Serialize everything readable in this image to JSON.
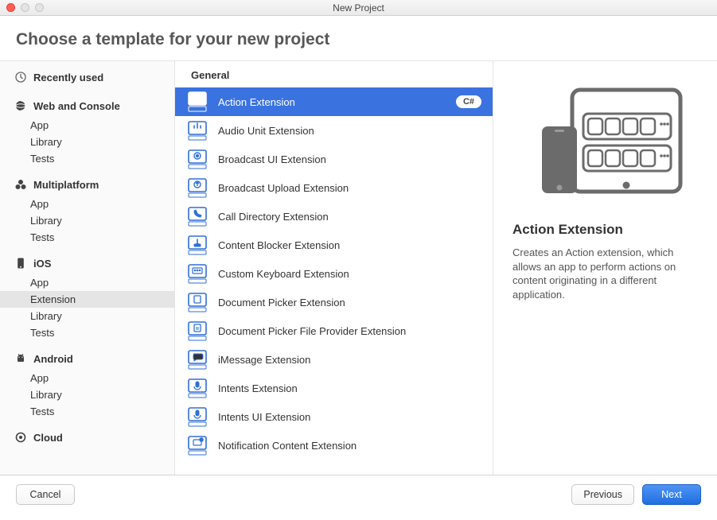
{
  "window": {
    "title": "New Project"
  },
  "header": {
    "title": "Choose a template for your new project"
  },
  "sidebar": {
    "recently_used": "Recently used",
    "categories": [
      {
        "name": "Web and Console",
        "items": [
          "App",
          "Library",
          "Tests"
        ]
      },
      {
        "name": "Multiplatform",
        "items": [
          "App",
          "Library",
          "Tests"
        ]
      },
      {
        "name": "iOS",
        "items": [
          "App",
          "Extension",
          "Library",
          "Tests"
        ],
        "selected_item": "Extension"
      },
      {
        "name": "Android",
        "items": [
          "App",
          "Library",
          "Tests"
        ]
      },
      {
        "name": "Cloud",
        "items": []
      }
    ]
  },
  "templates": {
    "group_label": "General",
    "items": [
      {
        "label": "Action Extension",
        "lang": "C#",
        "selected": true
      },
      {
        "label": "Audio Unit Extension"
      },
      {
        "label": "Broadcast UI Extension"
      },
      {
        "label": "Broadcast Upload Extension"
      },
      {
        "label": "Call Directory Extension"
      },
      {
        "label": "Content Blocker Extension"
      },
      {
        "label": "Custom Keyboard Extension"
      },
      {
        "label": "Document Picker Extension"
      },
      {
        "label": "Document Picker File Provider Extension"
      },
      {
        "label": "iMessage Extension"
      },
      {
        "label": "Intents Extension"
      },
      {
        "label": "Intents UI Extension"
      },
      {
        "label": "Notification Content Extension"
      }
    ]
  },
  "detail": {
    "title": "Action Extension",
    "description": "Creates an Action extension, which allows an app to perform actions on content originating in a different application."
  },
  "footer": {
    "cancel": "Cancel",
    "previous": "Previous",
    "next": "Next"
  }
}
